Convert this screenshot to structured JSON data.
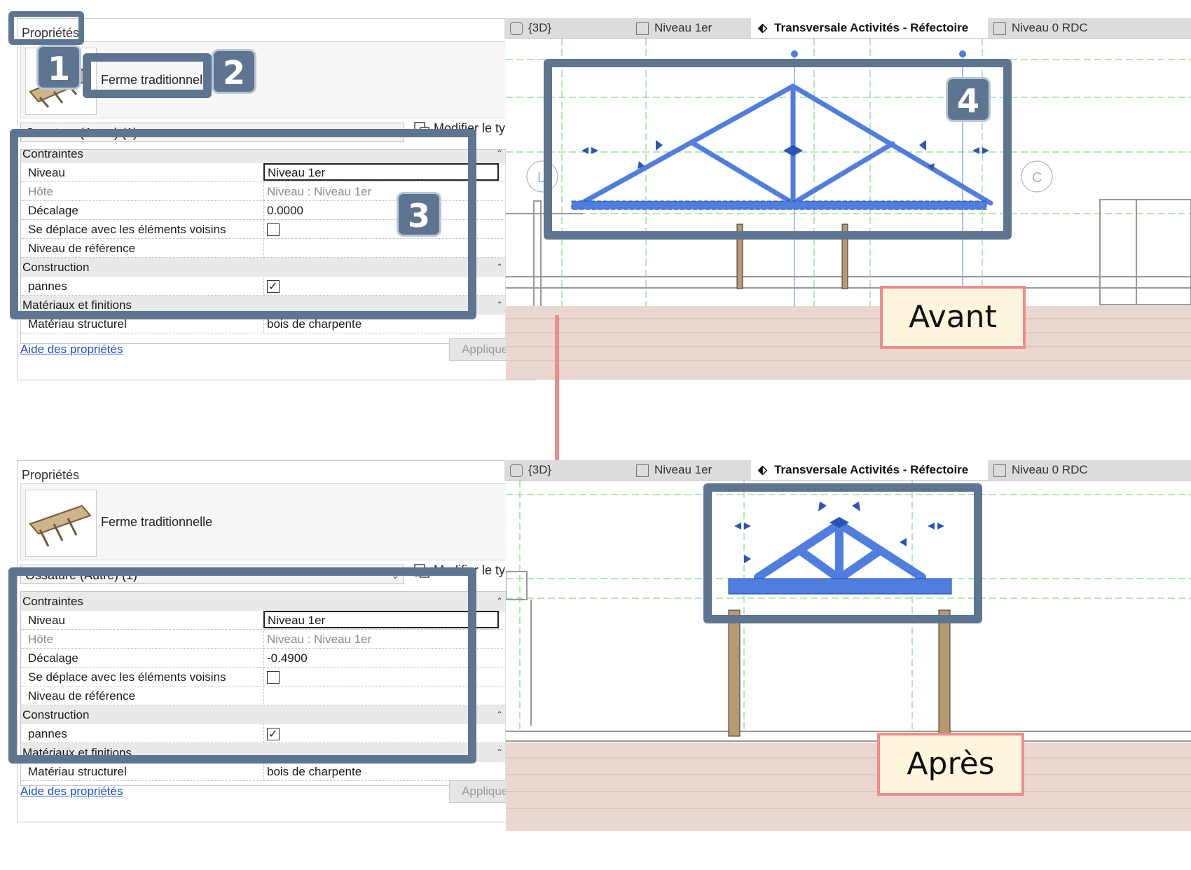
{
  "panels": [
    {
      "id": "before",
      "properties": {
        "title": "Propriétés",
        "close": "✕",
        "type_name": "Ferme traditionnelle",
        "category": "Ossature (Autre) (1)",
        "edit_type": "Modifier le type",
        "groups": {
          "constraints": "Contraintes",
          "construction": "Construction",
          "materials": "Matériaux et finitions"
        },
        "rows": {
          "level_label": "Niveau",
          "level_value": "Niveau 1er",
          "host_label": "Hôte",
          "host_value": "Niveau : Niveau 1er",
          "offset_label": "Décalage",
          "offset_value": "0.0000",
          "moves_label": "Se déplace avec les éléments voisins",
          "ref_label": "Niveau de référence",
          "purlins_label": "pannes",
          "material_label": "Matériau structurel",
          "material_value": "bois de charpente"
        },
        "help": "Aide des propriétés",
        "apply": "Appliquer"
      },
      "tabs": [
        "{3D}",
        "Niveau 1er",
        "Transversale Activités - Réfectoire",
        "Niveau 0 RDC"
      ],
      "tab_close": "✕",
      "grid_bubbles": [
        "L",
        "C"
      ],
      "state_label": "Avant"
    },
    {
      "id": "after",
      "properties": {
        "title": "Propriétés",
        "close": "✕",
        "type_name": "Ferme traditionnelle",
        "category": "Ossature (Autre) (1)",
        "edit_type": "Modifier le type",
        "groups": {
          "constraints": "Contraintes",
          "construction": "Construction",
          "materials": "Matériaux et finitions"
        },
        "rows": {
          "level_label": "Niveau",
          "level_value": "Niveau 1er",
          "host_label": "Hôte",
          "host_value": "Niveau : Niveau 1er",
          "offset_label": "Décalage",
          "offset_value": "-0.4900",
          "moves_label": "Se déplace avec les éléments voisins",
          "ref_label": "Niveau de référence",
          "purlins_label": "pannes",
          "material_label": "Matériau structurel",
          "material_value": "bois de charpente"
        },
        "help": "Aide des propriétés",
        "apply": "Appliquer"
      },
      "tabs": [
        "{3D}",
        "Niveau 1er",
        "Transversale Activités - Réfectoire",
        "Niveau 0 RDC"
      ],
      "tab_close": "✕",
      "state_label": "Après"
    }
  ],
  "badges": [
    "1",
    "2",
    "3",
    "4"
  ],
  "colors": {
    "frame": "#5e7592",
    "truss": "#4f7ee0",
    "arrow": "#f08c8c",
    "label_bg": "#fdf5dc"
  }
}
